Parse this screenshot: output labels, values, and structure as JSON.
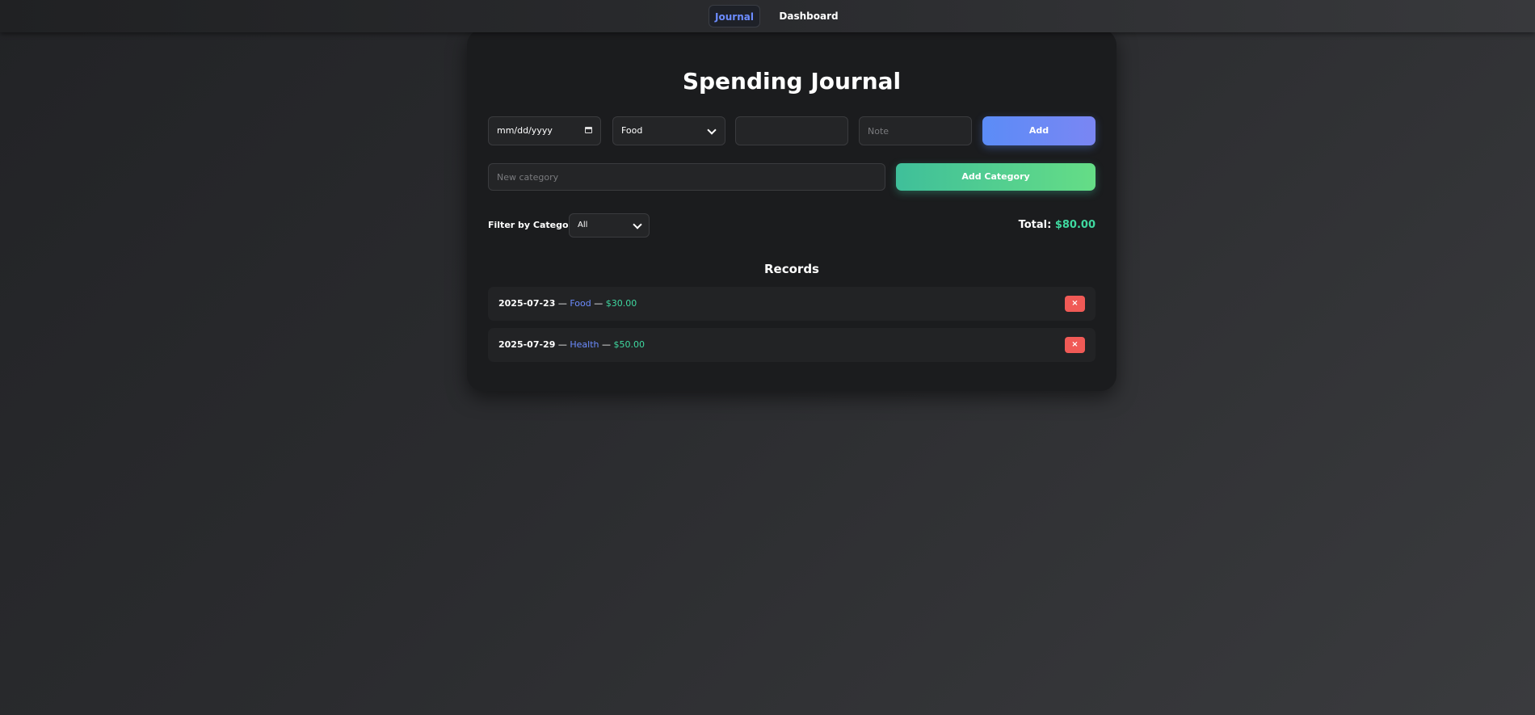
{
  "nav": {
    "tabs": [
      {
        "label": "Journal",
        "active": true
      },
      {
        "label": "Dashboard",
        "active": false
      }
    ]
  },
  "app": {
    "title": "Spending Journal"
  },
  "entry_form": {
    "date_placeholder": "mm/dd/yyyy",
    "category_value": "Food",
    "amount_value": "",
    "note_placeholder": "Note",
    "add_label": "Add"
  },
  "category_form": {
    "new_category_placeholder": "New category",
    "add_category_label": "Add Category"
  },
  "filter": {
    "label": "Filter by Category:",
    "selected": "All"
  },
  "summary": {
    "total_label": "Total:",
    "total_value": "$80.00"
  },
  "records": {
    "heading": "Records",
    "separator": "—",
    "items": [
      {
        "date": "2025-07-23",
        "category": "Food",
        "amount": "$30.00",
        "delete_label": "×"
      },
      {
        "date": "2025-07-29",
        "category": "Health",
        "amount": "$50.00",
        "delete_label": "×"
      }
    ]
  },
  "colors": {
    "accent_blue": "#6c8cff",
    "accent_green": "#3fd9a0",
    "delete_red": "#f05a56"
  }
}
